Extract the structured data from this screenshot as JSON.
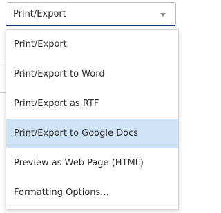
{
  "dropdown": {
    "selected_value": "Print/Export",
    "options": [
      {
        "label": "Print/Export"
      },
      {
        "label": "Print/Export to Word"
      },
      {
        "label": "Print/Export as RTF"
      },
      {
        "label": "Print/Export to Google Docs",
        "highlighted": true
      },
      {
        "label": "Preview as Web Page (HTML)"
      },
      {
        "label": "Formatting Options..."
      }
    ],
    "caret_icon": "chevron-down-icon"
  },
  "colors": {
    "border_focus": "#1d3b73",
    "highlight": "#cfe2f3",
    "text": "#2e2e2e"
  }
}
